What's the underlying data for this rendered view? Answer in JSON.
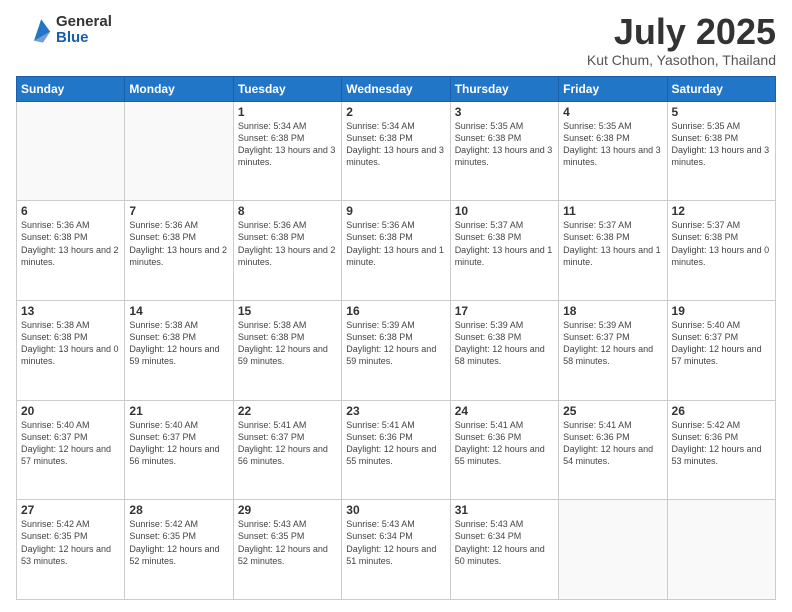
{
  "header": {
    "logo_general": "General",
    "logo_blue": "Blue",
    "title": "July 2025",
    "subtitle": "Kut Chum, Yasothon, Thailand"
  },
  "calendar": {
    "days_of_week": [
      "Sunday",
      "Monday",
      "Tuesday",
      "Wednesday",
      "Thursday",
      "Friday",
      "Saturday"
    ],
    "weeks": [
      [
        {
          "day": "",
          "info": ""
        },
        {
          "day": "",
          "info": ""
        },
        {
          "day": "1",
          "info": "Sunrise: 5:34 AM\nSunset: 6:38 PM\nDaylight: 13 hours and 3 minutes."
        },
        {
          "day": "2",
          "info": "Sunrise: 5:34 AM\nSunset: 6:38 PM\nDaylight: 13 hours and 3 minutes."
        },
        {
          "day": "3",
          "info": "Sunrise: 5:35 AM\nSunset: 6:38 PM\nDaylight: 13 hours and 3 minutes."
        },
        {
          "day": "4",
          "info": "Sunrise: 5:35 AM\nSunset: 6:38 PM\nDaylight: 13 hours and 3 minutes."
        },
        {
          "day": "5",
          "info": "Sunrise: 5:35 AM\nSunset: 6:38 PM\nDaylight: 13 hours and 3 minutes."
        }
      ],
      [
        {
          "day": "6",
          "info": "Sunrise: 5:36 AM\nSunset: 6:38 PM\nDaylight: 13 hours and 2 minutes."
        },
        {
          "day": "7",
          "info": "Sunrise: 5:36 AM\nSunset: 6:38 PM\nDaylight: 13 hours and 2 minutes."
        },
        {
          "day": "8",
          "info": "Sunrise: 5:36 AM\nSunset: 6:38 PM\nDaylight: 13 hours and 2 minutes."
        },
        {
          "day": "9",
          "info": "Sunrise: 5:36 AM\nSunset: 6:38 PM\nDaylight: 13 hours and 1 minute."
        },
        {
          "day": "10",
          "info": "Sunrise: 5:37 AM\nSunset: 6:38 PM\nDaylight: 13 hours and 1 minute."
        },
        {
          "day": "11",
          "info": "Sunrise: 5:37 AM\nSunset: 6:38 PM\nDaylight: 13 hours and 1 minute."
        },
        {
          "day": "12",
          "info": "Sunrise: 5:37 AM\nSunset: 6:38 PM\nDaylight: 13 hours and 0 minutes."
        }
      ],
      [
        {
          "day": "13",
          "info": "Sunrise: 5:38 AM\nSunset: 6:38 PM\nDaylight: 13 hours and 0 minutes."
        },
        {
          "day": "14",
          "info": "Sunrise: 5:38 AM\nSunset: 6:38 PM\nDaylight: 12 hours and 59 minutes."
        },
        {
          "day": "15",
          "info": "Sunrise: 5:38 AM\nSunset: 6:38 PM\nDaylight: 12 hours and 59 minutes."
        },
        {
          "day": "16",
          "info": "Sunrise: 5:39 AM\nSunset: 6:38 PM\nDaylight: 12 hours and 59 minutes."
        },
        {
          "day": "17",
          "info": "Sunrise: 5:39 AM\nSunset: 6:38 PM\nDaylight: 12 hours and 58 minutes."
        },
        {
          "day": "18",
          "info": "Sunrise: 5:39 AM\nSunset: 6:37 PM\nDaylight: 12 hours and 58 minutes."
        },
        {
          "day": "19",
          "info": "Sunrise: 5:40 AM\nSunset: 6:37 PM\nDaylight: 12 hours and 57 minutes."
        }
      ],
      [
        {
          "day": "20",
          "info": "Sunrise: 5:40 AM\nSunset: 6:37 PM\nDaylight: 12 hours and 57 minutes."
        },
        {
          "day": "21",
          "info": "Sunrise: 5:40 AM\nSunset: 6:37 PM\nDaylight: 12 hours and 56 minutes."
        },
        {
          "day": "22",
          "info": "Sunrise: 5:41 AM\nSunset: 6:37 PM\nDaylight: 12 hours and 56 minutes."
        },
        {
          "day": "23",
          "info": "Sunrise: 5:41 AM\nSunset: 6:36 PM\nDaylight: 12 hours and 55 minutes."
        },
        {
          "day": "24",
          "info": "Sunrise: 5:41 AM\nSunset: 6:36 PM\nDaylight: 12 hours and 55 minutes."
        },
        {
          "day": "25",
          "info": "Sunrise: 5:41 AM\nSunset: 6:36 PM\nDaylight: 12 hours and 54 minutes."
        },
        {
          "day": "26",
          "info": "Sunrise: 5:42 AM\nSunset: 6:36 PM\nDaylight: 12 hours and 53 minutes."
        }
      ],
      [
        {
          "day": "27",
          "info": "Sunrise: 5:42 AM\nSunset: 6:35 PM\nDaylight: 12 hours and 53 minutes."
        },
        {
          "day": "28",
          "info": "Sunrise: 5:42 AM\nSunset: 6:35 PM\nDaylight: 12 hours and 52 minutes."
        },
        {
          "day": "29",
          "info": "Sunrise: 5:43 AM\nSunset: 6:35 PM\nDaylight: 12 hours and 52 minutes."
        },
        {
          "day": "30",
          "info": "Sunrise: 5:43 AM\nSunset: 6:34 PM\nDaylight: 12 hours and 51 minutes."
        },
        {
          "day": "31",
          "info": "Sunrise: 5:43 AM\nSunset: 6:34 PM\nDaylight: 12 hours and 50 minutes."
        },
        {
          "day": "",
          "info": ""
        },
        {
          "day": "",
          "info": ""
        }
      ]
    ]
  }
}
